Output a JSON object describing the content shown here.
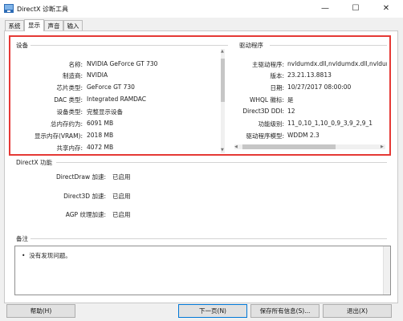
{
  "window": {
    "title": "DirectX 诊断工具",
    "minimize_glyph": "—",
    "maximize_glyph": "☐",
    "close_glyph": "✕"
  },
  "tabs": [
    {
      "label": "系统"
    },
    {
      "label": "显示",
      "active": true
    },
    {
      "label": "声音"
    },
    {
      "label": "输入"
    }
  ],
  "device": {
    "section_label": "设备",
    "rows": [
      {
        "label": "名称:",
        "value": "NVIDIA GeForce GT 730"
      },
      {
        "label": "制造商:",
        "value": "NVIDIA"
      },
      {
        "label": "芯片类型:",
        "value": "GeForce GT 730"
      },
      {
        "label": "DAC 类型:",
        "value": "Integrated RAMDAC"
      },
      {
        "label": "设备类型:",
        "value": "完整显示设备"
      },
      {
        "label": "总内存约为:",
        "value": "6091 MB"
      },
      {
        "label": "显示内存(VRAM):",
        "value": "2018 MB"
      },
      {
        "label": "共享内存:",
        "value": "4072 MB"
      }
    ]
  },
  "driver": {
    "section_label": "驱动程序",
    "rows": [
      {
        "label": "主驱动程序:",
        "value": "nvldumdx.dll,nvldumdx.dll,nvldumdx.dll,n"
      },
      {
        "label": "版本:",
        "value": "23.21.13.8813"
      },
      {
        "label": "日期:",
        "value": "10/27/2017 08:00:00"
      },
      {
        "label": "WHQL 徽标:",
        "value": "是"
      },
      {
        "label": "Direct3D DDI:",
        "value": "12"
      },
      {
        "label": "功能级别:",
        "value": "11_0,10_1,10_0,9_3,9_2,9_1"
      },
      {
        "label": "驱动程序模型:",
        "value": "WDDM 2.3"
      }
    ]
  },
  "directx_features": {
    "section_label": "DirectX 功能",
    "rows": [
      {
        "label": "DirectDraw 加速:",
        "value": "已启用"
      },
      {
        "label": "Direct3D 加速:",
        "value": "已启用"
      },
      {
        "label": "AGP 纹理加速:",
        "value": "已启用"
      }
    ]
  },
  "notes": {
    "section_label": "备注",
    "text": "没有发现问题。"
  },
  "buttons": {
    "help": "帮助(H)",
    "next_page": "下一页(N)",
    "save_all": "保存所有信息(S)...",
    "exit": "退出(X)"
  },
  "colors": {
    "highlight_frame": "#e53935",
    "default_button_border": "#0078d7"
  }
}
